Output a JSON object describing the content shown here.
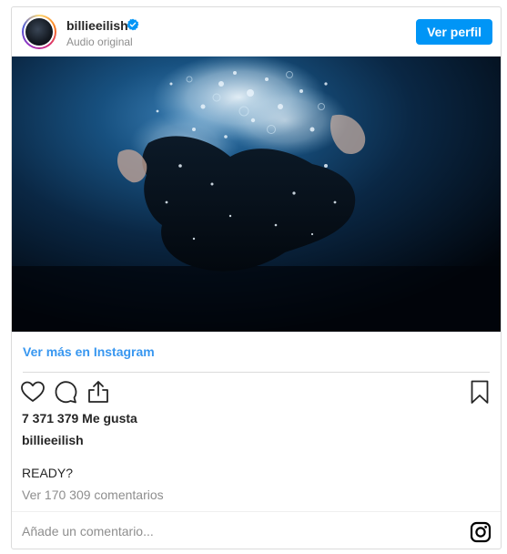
{
  "post": {
    "username": "billieeilish",
    "subtitle": "Audio original",
    "view_profile_label": "Ver perfil",
    "more_link": "Ver más en Instagram",
    "likes": "7 371 379 Me gusta",
    "caption_user": "billieeilish",
    "caption_text": "READY?",
    "comments_link": "Ver 170 309 comentarios",
    "comment_placeholder": "Añade un comentario...",
    "verified": true
  },
  "icons": {
    "verified": "verified-badge-icon",
    "like": "heart-icon",
    "comment": "comment-bubble-icon",
    "share": "share-icon",
    "save": "bookmark-icon",
    "logo": "instagram-logo-icon"
  },
  "colors": {
    "accent": "#0095f6",
    "link": "#3897f0",
    "text": "#262626",
    "muted": "#8e8e8e",
    "border": "#dbdbdb"
  }
}
